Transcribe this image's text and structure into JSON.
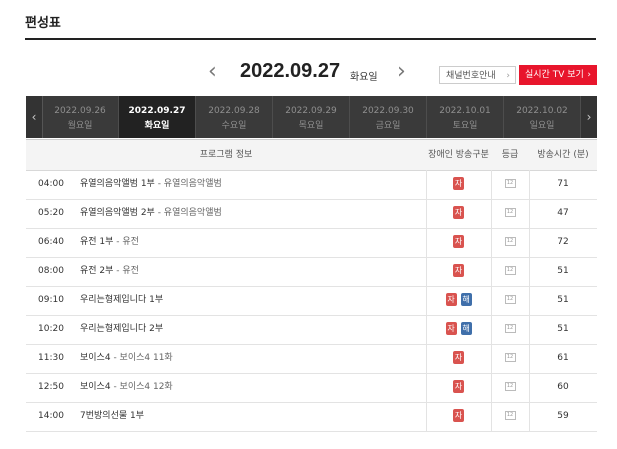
{
  "page": {
    "title": "편성표"
  },
  "nav": {
    "prev_icon": "chevron-left-icon",
    "next_icon": "chevron-right-icon",
    "current_date": "2022.09.27",
    "current_day": "화요일",
    "prev_glyph": "‹",
    "next_glyph": "›",
    "channel_guide_label": "채널번호안내",
    "live_tv_label": "실시간 TV 보기",
    "chevron": "›"
  },
  "tabs": [
    {
      "date": "2022.09.26",
      "day": "월요일",
      "active": false
    },
    {
      "date": "2022.09.27",
      "day": "화요일",
      "active": true
    },
    {
      "date": "2022.09.28",
      "day": "수요일",
      "active": false
    },
    {
      "date": "2022.09.29",
      "day": "목요일",
      "active": false
    },
    {
      "date": "2022.09.30",
      "day": "금요일",
      "active": false
    },
    {
      "date": "2022.10.01",
      "day": "토요일",
      "active": false
    },
    {
      "date": "2022.10.02",
      "day": "일요일",
      "active": false
    }
  ],
  "table": {
    "headers": {
      "program": "프로그램 정보",
      "disability": "장애인 방송구분",
      "grade": "등급",
      "duration": "방송시간 (분)"
    },
    "badges": {
      "cc": "자",
      "sign": "해"
    },
    "grade_icon_label": "12",
    "rows": [
      {
        "time": "04:00",
        "title": "유열의음악앨범 1부",
        "sub": " - 유열의음악앨범",
        "cc": true,
        "sign": false,
        "duration": "71"
      },
      {
        "time": "05:20",
        "title": "유열의음악앨범 2부",
        "sub": " - 유열의음악앨범",
        "cc": true,
        "sign": false,
        "duration": "47"
      },
      {
        "time": "06:40",
        "title": "유전 1부",
        "sub": " - 유전",
        "cc": true,
        "sign": false,
        "duration": "72"
      },
      {
        "time": "08:00",
        "title": "유전 2부",
        "sub": " - 유전",
        "cc": true,
        "sign": false,
        "duration": "51"
      },
      {
        "time": "09:10",
        "title": "우리는형제입니다 1부",
        "sub": "",
        "cc": true,
        "sign": true,
        "duration": "51"
      },
      {
        "time": "10:20",
        "title": "우리는형제입니다 2부",
        "sub": "",
        "cc": true,
        "sign": true,
        "duration": "51"
      },
      {
        "time": "11:30",
        "title": "보이스4",
        "sub": " - 보이스4 11화",
        "cc": true,
        "sign": false,
        "duration": "61"
      },
      {
        "time": "12:50",
        "title": "보이스4",
        "sub": " - 보이스4 12화",
        "cc": true,
        "sign": false,
        "duration": "60"
      },
      {
        "time": "14:00",
        "title": "7번방의선물 1부",
        "sub": "",
        "cc": true,
        "sign": false,
        "duration": "59"
      }
    ]
  }
}
